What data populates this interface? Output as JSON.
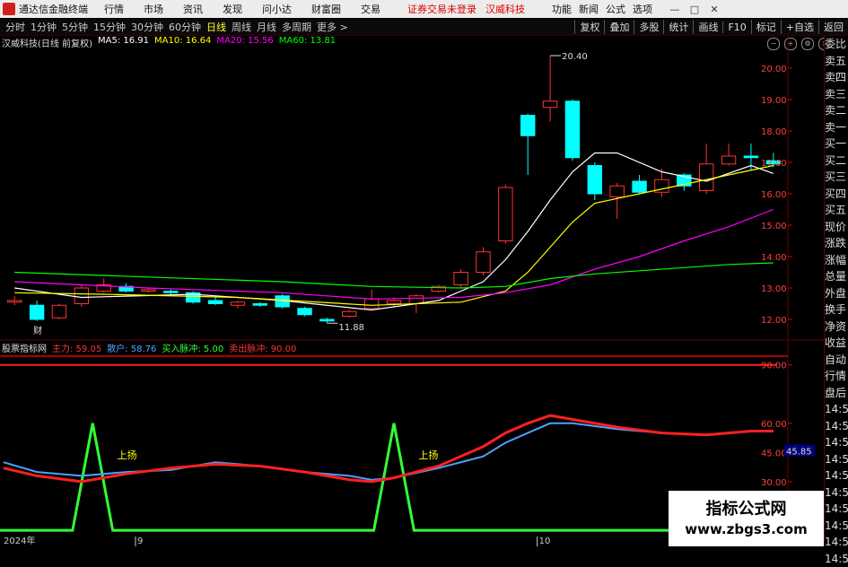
{
  "menubar": {
    "app_title": "通达信金融终端",
    "items": [
      "行情",
      "市场",
      "资讯",
      "发现",
      "问小达",
      "财富圈",
      "交易"
    ],
    "notice": "证券交易未登录",
    "stock_name": "汉威科技",
    "right_items": [
      "功能",
      "新闻",
      "公式",
      "选项"
    ],
    "win_min": "—",
    "win_max": "□",
    "win_close": "✕"
  },
  "periodbar": {
    "periods": [
      "分时",
      "1分钟",
      "5分钟",
      "15分钟",
      "30分钟",
      "60分钟",
      "日线",
      "周线",
      "月线",
      "多周期",
      "更多 >"
    ],
    "active": "日线",
    "tools": [
      "复权",
      "叠加",
      "多股",
      "统计",
      "画线",
      "F10",
      "标记",
      "+自选",
      "返回"
    ]
  },
  "main_info": {
    "title": "汉威科技(日线 前复权)",
    "ma5": "MA5: 16.91",
    "ma10": "MA10: 16.64",
    "ma20": "MA20: 15.56",
    "ma60": "MA60: 13.81"
  },
  "price_axis": [
    "20.00",
    "19.00",
    "18.00",
    "17.00",
    "16.00",
    "15.00",
    "14.00",
    "13.00",
    "12.00"
  ],
  "annotations": {
    "high": "20.40",
    "low": "11.88",
    "cai": "财"
  },
  "indicator_info": {
    "name": "股票指标网",
    "zhuli": "主力: 59.05",
    "sanhu": "散户: 58.76",
    "buy": "买入脉冲: 5.00",
    "sell": "卖出脉冲: 90.00"
  },
  "indicator_axis": [
    "90.00",
    "60.00",
    "45.00",
    "30.00"
  ],
  "indicator_current": "45.85",
  "indicator_labels": {
    "up1": "上扬",
    "up2": "上扬"
  },
  "date_axis": [
    "2024年",
    "9",
    "10"
  ],
  "right_column": [
    "委比",
    "卖五",
    "卖四",
    "卖三",
    "卖二",
    "卖一",
    "买一",
    "买二",
    "买三",
    "买四",
    "买五",
    "现价",
    "涨跌",
    "涨幅",
    "总量",
    "外盘",
    "换手",
    "净资",
    "收益",
    "自动",
    "行情",
    "盘后",
    "14:56",
    "14:56",
    "14:56",
    "14:56",
    "14:56",
    "14:56",
    "14:56",
    "14:56",
    "14:56",
    "14:56"
  ],
  "watermark": {
    "line1": "指标公式网",
    "line2": "www.zbgs3.com"
  },
  "colors": {
    "up": "#ff3333",
    "down": "#00ffff",
    "ma5": "#ffffff",
    "ma10": "#ffff00",
    "ma20": "#ff00ff",
    "ma60": "#00ff00",
    "zhuli": "#ff2020",
    "sanhu": "#4f9fff",
    "pulse": "#33ff33"
  },
  "chart_data": {
    "type": "candlestick",
    "y_range": [
      11.6,
      20.6
    ],
    "candles": [
      {
        "o": 12.55,
        "h": 12.75,
        "l": 12.45,
        "c": 12.6
      },
      {
        "o": 12.45,
        "h": 12.6,
        "l": 11.95,
        "c": 12.0
      },
      {
        "o": 12.05,
        "h": 12.5,
        "l": 12.0,
        "c": 12.45
      },
      {
        "o": 12.5,
        "h": 13.1,
        "l": 12.4,
        "c": 13.0
      },
      {
        "o": 12.9,
        "h": 13.3,
        "l": 12.85,
        "c": 13.1
      },
      {
        "o": 13.05,
        "h": 13.15,
        "l": 12.85,
        "c": 12.9
      },
      {
        "o": 12.9,
        "h": 13.0,
        "l": 12.85,
        "c": 12.95
      },
      {
        "o": 12.9,
        "h": 12.95,
        "l": 12.75,
        "c": 12.85
      },
      {
        "o": 12.85,
        "h": 12.9,
        "l": 12.5,
        "c": 12.55
      },
      {
        "o": 12.6,
        "h": 12.7,
        "l": 12.45,
        "c": 12.5
      },
      {
        "o": 12.45,
        "h": 12.6,
        "l": 12.35,
        "c": 12.55
      },
      {
        "o": 12.5,
        "h": 12.55,
        "l": 12.4,
        "c": 12.45
      },
      {
        "o": 12.75,
        "h": 12.8,
        "l": 12.35,
        "c": 12.4
      },
      {
        "o": 12.35,
        "h": 12.4,
        "l": 12.1,
        "c": 12.15
      },
      {
        "o": 12.0,
        "h": 12.05,
        "l": 11.88,
        "c": 11.95
      },
      {
        "o": 12.1,
        "h": 12.3,
        "l": 12.05,
        "c": 12.25
      },
      {
        "o": 12.35,
        "h": 12.95,
        "l": 12.3,
        "c": 12.65
      },
      {
        "o": 12.5,
        "h": 12.7,
        "l": 12.4,
        "c": 12.6
      },
      {
        "o": 12.5,
        "h": 12.8,
        "l": 12.2,
        "c": 12.75
      },
      {
        "o": 12.9,
        "h": 13.1,
        "l": 12.85,
        "c": 13.05
      },
      {
        "o": 13.1,
        "h": 13.6,
        "l": 13.0,
        "c": 13.5
      },
      {
        "o": 13.5,
        "h": 14.3,
        "l": 13.4,
        "c": 14.15
      },
      {
        "o": 14.5,
        "h": 16.3,
        "l": 14.4,
        "c": 16.2
      },
      {
        "o": 18.5,
        "h": 18.55,
        "l": 16.6,
        "c": 17.85
      },
      {
        "o": 18.75,
        "h": 20.4,
        "l": 18.3,
        "c": 18.95
      },
      {
        "o": 18.95,
        "h": 19.0,
        "l": 17.05,
        "c": 17.15
      },
      {
        "o": 16.9,
        "h": 17.0,
        "l": 15.8,
        "c": 16.0
      },
      {
        "o": 15.9,
        "h": 16.35,
        "l": 15.2,
        "c": 16.25
      },
      {
        "o": 16.4,
        "h": 16.6,
        "l": 16.0,
        "c": 16.05
      },
      {
        "o": 16.05,
        "h": 16.8,
        "l": 15.9,
        "c": 16.45
      },
      {
        "o": 16.6,
        "h": 16.65,
        "l": 16.1,
        "c": 16.25
      },
      {
        "o": 16.1,
        "h": 17.6,
        "l": 16.0,
        "c": 16.95
      },
      {
        "o": 16.95,
        "h": 17.6,
        "l": 16.9,
        "c": 17.2
      },
      {
        "o": 17.2,
        "h": 17.6,
        "l": 16.75,
        "c": 17.15
      },
      {
        "o": 17.05,
        "h": 17.3,
        "l": 16.85,
        "c": 16.95
      }
    ],
    "ma_series": [
      {
        "name": "MA5",
        "values": [
          [
            0,
            13.0
          ],
          [
            3,
            12.7
          ],
          [
            8,
            12.8
          ],
          [
            12,
            12.6
          ],
          [
            16,
            12.3
          ],
          [
            19,
            12.6
          ],
          [
            21,
            13.2
          ],
          [
            22,
            13.9
          ],
          [
            23,
            14.8
          ],
          [
            24,
            15.8
          ],
          [
            25,
            16.7
          ],
          [
            26,
            17.3
          ],
          [
            27,
            17.3
          ],
          [
            29,
            16.7
          ],
          [
            31,
            16.4
          ],
          [
            33,
            16.9
          ],
          [
            34,
            16.65
          ]
        ]
      },
      {
        "name": "MA10",
        "values": [
          [
            0,
            12.85
          ],
          [
            4,
            12.8
          ],
          [
            10,
            12.7
          ],
          [
            16,
            12.45
          ],
          [
            20,
            12.55
          ],
          [
            22,
            12.9
          ],
          [
            23,
            13.5
          ],
          [
            24,
            14.3
          ],
          [
            25,
            15.1
          ],
          [
            26,
            15.7
          ],
          [
            28,
            16.0
          ],
          [
            30,
            16.3
          ],
          [
            32,
            16.6
          ],
          [
            34,
            16.9
          ]
        ]
      },
      {
        "name": "MA20",
        "values": [
          [
            0,
            13.2
          ],
          [
            6,
            13.0
          ],
          [
            12,
            12.85
          ],
          [
            16,
            12.65
          ],
          [
            20,
            12.7
          ],
          [
            22,
            12.85
          ],
          [
            24,
            13.1
          ],
          [
            26,
            13.6
          ],
          [
            28,
            14.0
          ],
          [
            30,
            14.5
          ],
          [
            32,
            14.95
          ],
          [
            34,
            15.5
          ]
        ]
      },
      {
        "name": "MA60",
        "values": [
          [
            0,
            13.5
          ],
          [
            6,
            13.35
          ],
          [
            12,
            13.2
          ],
          [
            16,
            13.05
          ],
          [
            20,
            13.0
          ],
          [
            22,
            13.05
          ],
          [
            24,
            13.3
          ],
          [
            26,
            13.45
          ],
          [
            28,
            13.55
          ],
          [
            30,
            13.65
          ],
          [
            32,
            13.75
          ],
          [
            34,
            13.8
          ]
        ]
      }
    ],
    "indicator": {
      "y_range": [
        0,
        100
      ],
      "zhuli": [
        [
          -0.5,
          37
        ],
        [
          1,
          33
        ],
        [
          3,
          30
        ],
        [
          5,
          34
        ],
        [
          7,
          37
        ],
        [
          9,
          39
        ],
        [
          11,
          38
        ],
        [
          13,
          35
        ],
        [
          15,
          31
        ],
        [
          16,
          30
        ],
        [
          17,
          32
        ],
        [
          19,
          38
        ],
        [
          21,
          48
        ],
        [
          22,
          55
        ],
        [
          23,
          60
        ],
        [
          24,
          64
        ],
        [
          25,
          62
        ],
        [
          27,
          58
        ],
        [
          29,
          55
        ],
        [
          31,
          54
        ],
        [
          33,
          56
        ],
        [
          34,
          56
        ]
      ],
      "sanhu": [
        [
          -0.5,
          40
        ],
        [
          1,
          35
        ],
        [
          3,
          33
        ],
        [
          5,
          35
        ],
        [
          7,
          36
        ],
        [
          9,
          40
        ],
        [
          11,
          38
        ],
        [
          13,
          35
        ],
        [
          15,
          33
        ],
        [
          16,
          31
        ],
        [
          17,
          32
        ],
        [
          19,
          37
        ],
        [
          21,
          43
        ],
        [
          22,
          50
        ],
        [
          23,
          55
        ],
        [
          24,
          60
        ],
        [
          25,
          60
        ],
        [
          27,
          57
        ],
        [
          29,
          55
        ],
        [
          31,
          54
        ],
        [
          33,
          56
        ],
        [
          34,
          56
        ]
      ],
      "pulse_peaks": [
        3.5,
        17.0
      ],
      "pulse_low": 5,
      "pulse_high": 60
    }
  }
}
